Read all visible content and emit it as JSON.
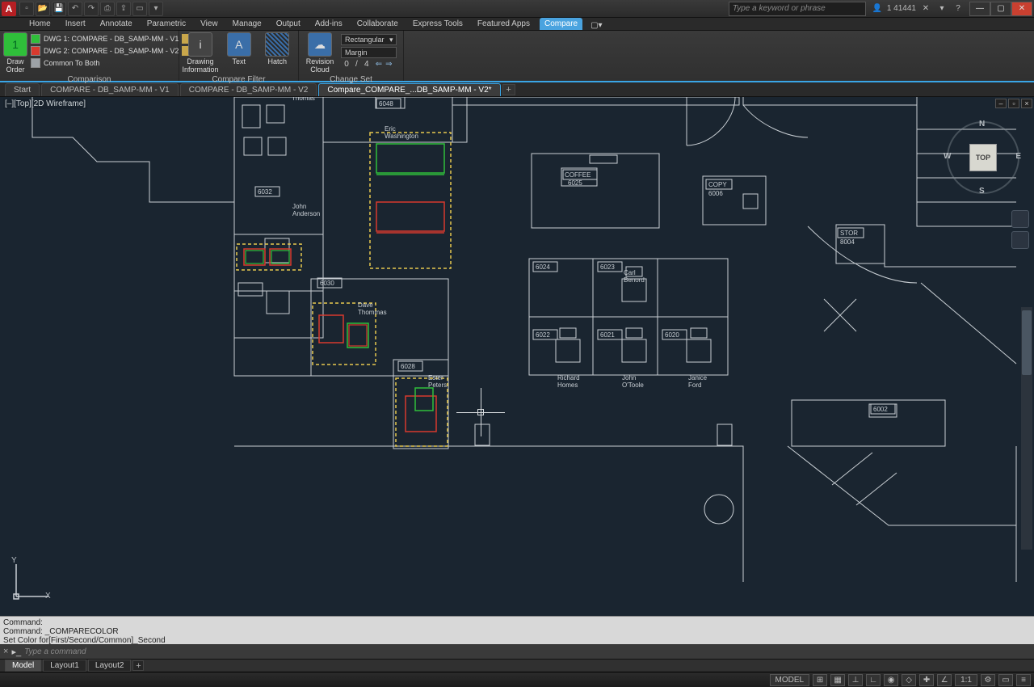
{
  "app": {
    "letter": "A"
  },
  "qat": {
    "tips": [
      "new",
      "open",
      "save",
      "undo",
      "redo",
      "plot",
      "share",
      "select",
      "recent"
    ]
  },
  "search": {
    "placeholder": "Type a keyword or phrase"
  },
  "title_right": {
    "user_label": "1 41441",
    "signin": "Sign In"
  },
  "window_controls": {
    "min": "—",
    "max": "▢",
    "close": "✕"
  },
  "ribbon_tabs": [
    "Home",
    "Insert",
    "Annotate",
    "Parametric",
    "View",
    "Manage",
    "Output",
    "Add-ins",
    "Collaborate",
    "Express Tools",
    "Featured Apps",
    "Compare"
  ],
  "ribbon_tabs_active": "Compare",
  "comparison_group": {
    "draw_order_label": "Draw\nOrder",
    "badge": "1",
    "dwg1_label": "DWG 1:  COMPARE - DB_SAMP-MM - V1",
    "dwg2_label": "DWG 2:  COMPARE - DB_SAMP-MM - V2",
    "common_label": "Common To Both",
    "title": "Comparison"
  },
  "compare_filter_group": {
    "info_label": "Drawing\nInformation",
    "text_label": "Text",
    "hatch_label": "Hatch",
    "title": "Compare Filter"
  },
  "change_set_group": {
    "cloud_label": "Revision\nCloud",
    "shape_label": "Rectangular",
    "margin_label": "Margin",
    "current": "0",
    "total": "4",
    "title": "Change Set"
  },
  "file_tabs": {
    "items": [
      "Start",
      "COMPARE - DB_SAMP-MM - V1",
      "COMPARE - DB_SAMP-MM - V2",
      "Compare_COMPARE_...DB_SAMP-MM - V2*"
    ],
    "active": 3
  },
  "viewport": {
    "label": "[–][Top][2D Wireframe]"
  },
  "viewcube": {
    "face": "TOP",
    "n": "N",
    "s": "S",
    "e": "E",
    "w": "W"
  },
  "ucs": {
    "x": "X",
    "y": "Y"
  },
  "room_labels": {
    "r6048": "6048",
    "r6032": "6032",
    "r6030": "6030",
    "r6028": "6028",
    "r6024": "6024",
    "r6023": "6023",
    "r6022": "6022",
    "r6021": "6021",
    "r6020": "6020",
    "r6002": "6002",
    "stor": "STOR",
    "stor_no": "8004",
    "copy": "COPY",
    "copy_no": "6006",
    "coffee": "COFFEE",
    "coffee_no": "6025",
    "n_thomas": "Thomas",
    "n_washington": "Eric\nWashington",
    "n_anderson": "John\nAnderson",
    "n_homes": "Richard\nHomes",
    "n_otoole": "John\nO'Toole",
    "n_ford": "Janice\nFord",
    "n_benord": "Carl\nBenord",
    "n_thommas": "Dave\nThommas",
    "n_peters": "Ester\nPeters"
  },
  "command_history": {
    "l1": "Command:",
    "l2": "Command: _COMPARECOLOR",
    "l3": "Set Color for[First/Second/Common]_Second"
  },
  "command_prompt": "Type a command",
  "layout_tabs": {
    "items": [
      "Model",
      "Layout1",
      "Layout2"
    ],
    "active": 0
  },
  "statusbar": {
    "mode": "MODEL",
    "scale": "1:1",
    "icons": [
      "⊞",
      "▦",
      "⊥",
      "∟",
      "◉",
      "◇",
      "✚",
      "∠",
      "☰",
      "⌖",
      "⚙",
      "▭",
      "≡"
    ]
  },
  "colors": {
    "dwg1": "#2fbf3a",
    "dwg2": "#d83a2e",
    "common": "#9da2a6",
    "cloud": "#e8c94f",
    "plan": "#c9cfd4",
    "canvas": "#1a2530"
  }
}
